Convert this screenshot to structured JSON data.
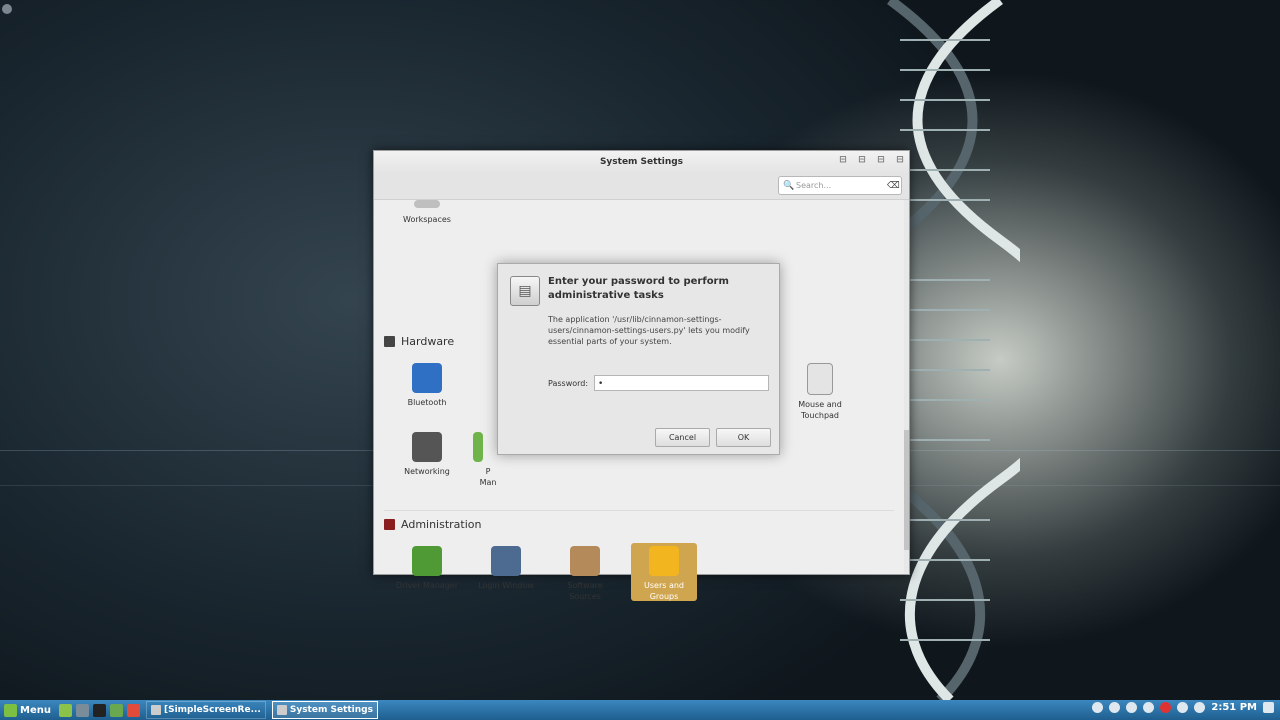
{
  "window": {
    "title": "System Settings",
    "search_placeholder": "Search...",
    "partial_item": "Workspaces"
  },
  "sections": {
    "hardware": "Hardware",
    "administration": "Administration"
  },
  "hardware_items": {
    "bluetooth": "Bluetooth",
    "mouse": "Mouse and Touchpad",
    "networking": "Networking",
    "power_partial": "P",
    "power_partial2": "Man"
  },
  "admin_items": {
    "driver": "Driver Manager",
    "login": "Login Window",
    "software": "Software Sources",
    "users": "Users and Groups"
  },
  "dialog": {
    "title": "Enter your password to perform administrative tasks",
    "message": "The application '/usr/lib/cinnamon-settings-users/cinnamon-settings-users.py' lets you modify essential parts of your system.",
    "password_label": "Password:",
    "password_value": "•",
    "cancel": "Cancel",
    "ok": "OK"
  },
  "taskbar": {
    "menu": "Menu",
    "tasks": [
      "[SimpleScreenRe...",
      "System Settings"
    ],
    "clock": "2:51 PM"
  },
  "colors": {
    "selected_item": "#cfa64f",
    "panel": "#2a70a5"
  }
}
